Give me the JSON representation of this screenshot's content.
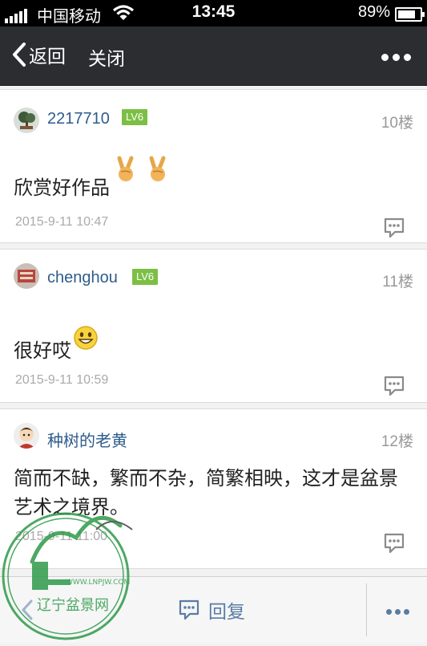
{
  "statusbar": {
    "carrier": "中国移动",
    "time": "13:45",
    "battery": "89%",
    "battery_level": 0.89
  },
  "nav": {
    "back_label": "返回",
    "close_label": "关闭"
  },
  "posts": [
    {
      "username": "2217710",
      "level": "LV6",
      "floor": "10楼",
      "text": "欣赏好作品",
      "emojis": [
        "victory-hand",
        "victory-hand"
      ],
      "time": "2015-9-11 10:47"
    },
    {
      "username": "chenghou",
      "level": "LV6",
      "floor": "11楼",
      "text": "很好哎",
      "emojis": [
        "smiley-face"
      ],
      "time": "2015-9-11 10:59"
    },
    {
      "username": "种树的老黄",
      "level": "",
      "floor": "12楼",
      "text": "简而不缺，繁而不杂，简繁相映，这才是盆景艺术之境界。",
      "emojis": [],
      "time": "2015-9-11 11:00"
    }
  ],
  "bottombar": {
    "reply_label": "回复"
  },
  "watermark": {
    "url": "WWW.LNPJW.COM",
    "name": "辽宁盆景网"
  },
  "colors": {
    "nav_bg": "#2b2d31",
    "username": "#2e5c8c",
    "level_badge": "#7cbf45",
    "link_blue": "#5a7ca4"
  }
}
